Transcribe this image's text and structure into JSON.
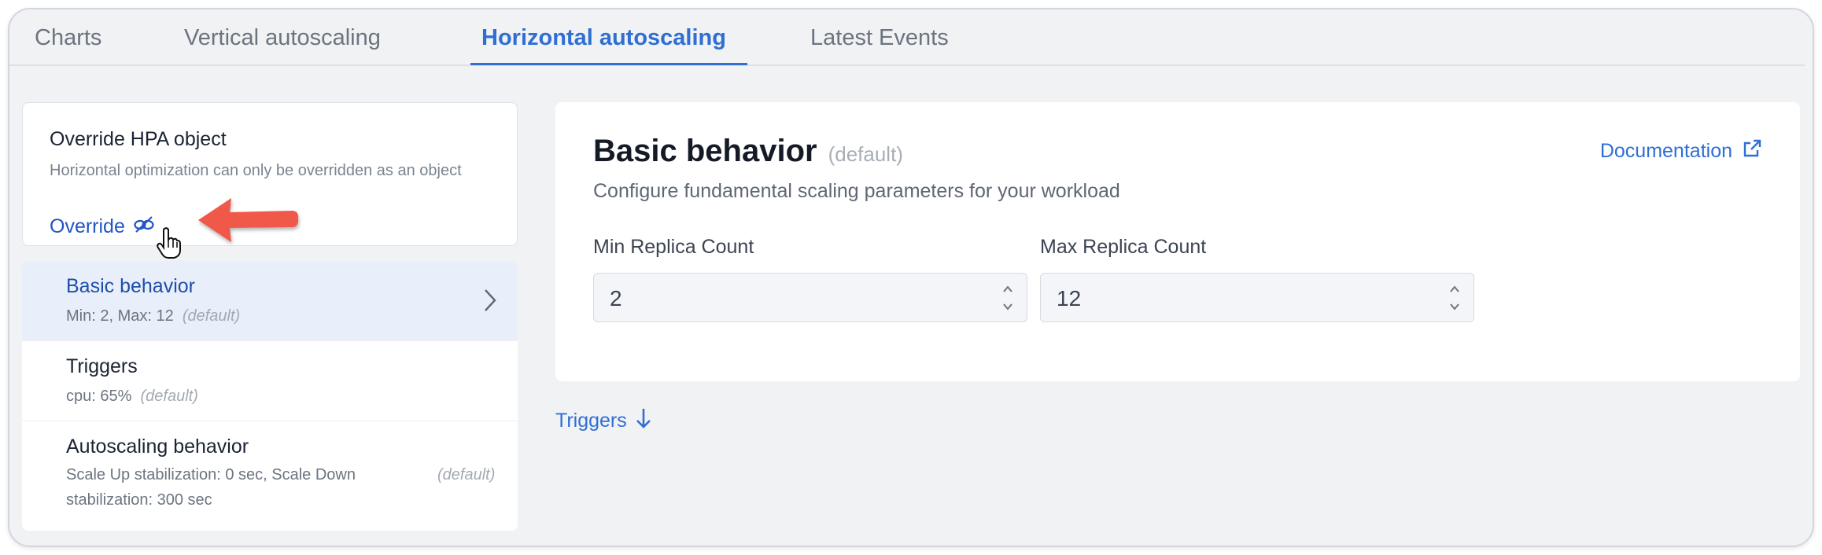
{
  "tabs": [
    {
      "label": "Charts",
      "active": false
    },
    {
      "label": "Vertical autoscaling",
      "active": false
    },
    {
      "label": "Horizontal autoscaling",
      "active": true
    },
    {
      "label": "Latest Events",
      "active": false
    }
  ],
  "override_card": {
    "title": "Override HPA object",
    "description": "Horizontal optimization can only be overridden as an object",
    "link_label": "Override",
    "link_icon": "unlink-icon"
  },
  "nav": {
    "items": [
      {
        "title": "Basic behavior",
        "subtitle": "Min: 2, Max: 12",
        "note": "(default)",
        "active": true
      },
      {
        "title": "Triggers",
        "subtitle": "cpu: 65%",
        "note": "(default)",
        "active": false
      },
      {
        "title": "Autoscaling behavior",
        "subtitle": "Scale Up stabilization: 0 sec, Scale Down stabilization: 300 sec",
        "note": "(default)",
        "active": false
      }
    ]
  },
  "panel": {
    "title": "Basic behavior",
    "title_note": "(default)",
    "subtitle": "Configure fundamental scaling parameters for your workload",
    "doc_link": "Documentation",
    "fields": [
      {
        "label": "Min Replica Count",
        "value": "2"
      },
      {
        "label": "Max Replica Count",
        "value": "12"
      }
    ]
  },
  "triggers_link": "Triggers",
  "colors": {
    "accent": "#2f6fd4",
    "arrow": "#f0584a",
    "active_bg": "#e8effb"
  }
}
